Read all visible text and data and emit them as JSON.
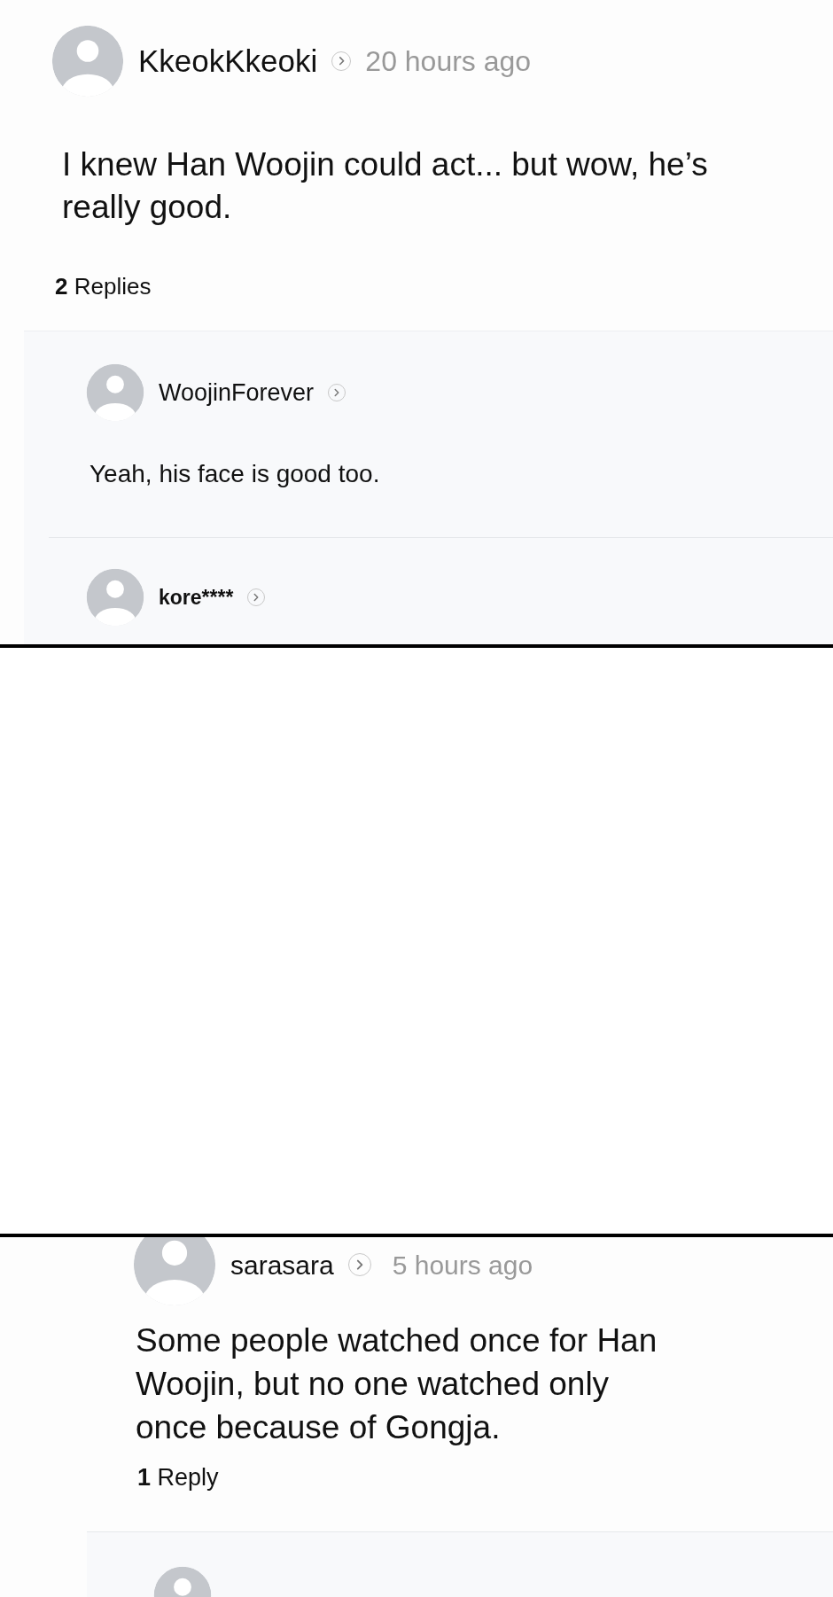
{
  "panels": [
    {
      "kind": "thread",
      "comment": {
        "username": "KkeokKkeoki",
        "time": "20 hours ago",
        "text": "I knew Han Woojin could act... but wow, he’s really good."
      },
      "reply_count": {
        "number": "2",
        "label": "Replies"
      },
      "replies": [
        {
          "username": "WoojinForever",
          "text": "Yeah, his face is good too."
        },
        {
          "username": "kore****"
        }
      ]
    },
    {
      "kind": "blank"
    },
    {
      "kind": "thread_bottom",
      "comment": {
        "username": "sarasara",
        "time": "5 hours ago",
        "text": "Some people watched once for Han Woojin, but no one watched only once because of Gongja."
      },
      "reply_count": {
        "number": "1",
        "label": "Reply"
      }
    }
  ]
}
